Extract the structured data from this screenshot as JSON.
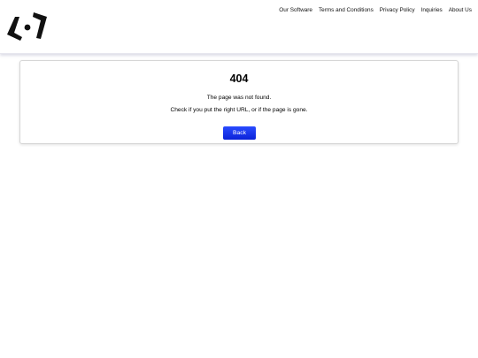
{
  "header": {
    "logo_icon": "brand-logo-icon",
    "nav": [
      {
        "label": "Our Software"
      },
      {
        "label": "Terms and Conditions"
      },
      {
        "label": "Privacy Policy"
      },
      {
        "label": "Inquiries"
      },
      {
        "label": "About Us"
      }
    ]
  },
  "error": {
    "code": "404",
    "message": "The page was not found.",
    "hint": "Check if you put the right URL, or if the page is gone.",
    "back_label": "Back"
  },
  "colors": {
    "button": "#1130e8",
    "logo": "#111111"
  }
}
